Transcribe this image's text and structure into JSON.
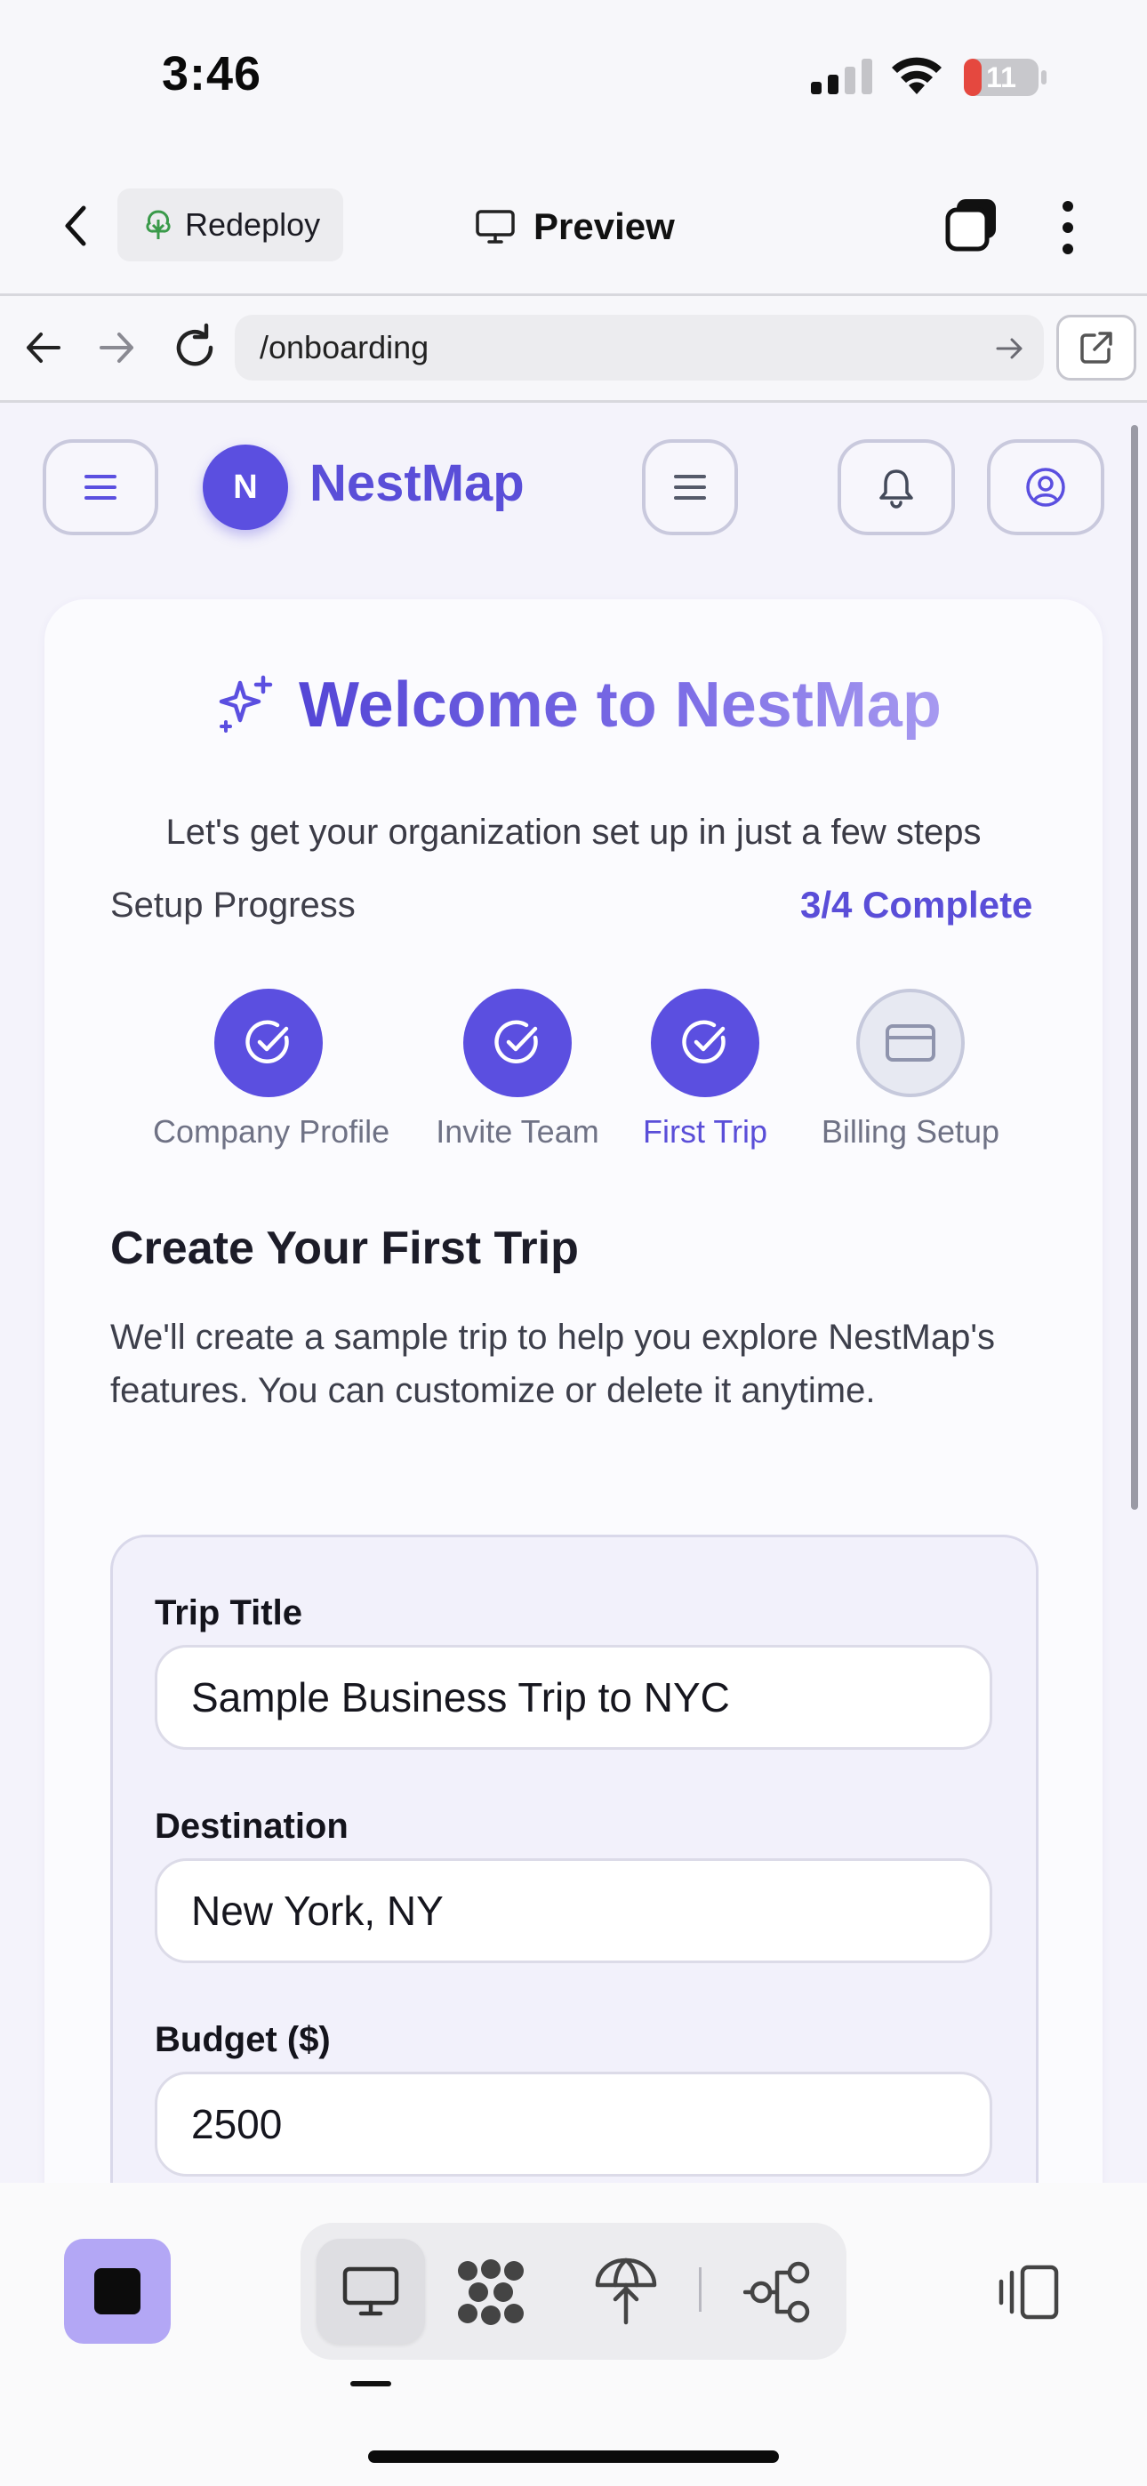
{
  "status_bar": {
    "time": "3:46",
    "battery_level": "11"
  },
  "app_header": {
    "redeploy_label": "Redeploy",
    "preview_label": "Preview"
  },
  "browser": {
    "url": "/onboarding"
  },
  "site_nav": {
    "brand_initial": "N",
    "brand_name": "NestMap"
  },
  "onboarding": {
    "title": "Welcome to NestMap",
    "subtitle": "Let's get your organization set up in just a few steps",
    "progress_label": "Setup Progress",
    "progress_value": "3/4 Complete",
    "progress_fraction": 0.75,
    "steps": [
      {
        "label": "Company Profile",
        "status": "complete",
        "icon": "check-circle-icon"
      },
      {
        "label": "Invite Team",
        "status": "complete",
        "icon": "check-circle-icon"
      },
      {
        "label": "First Trip",
        "status": "current",
        "icon": "check-circle-icon"
      },
      {
        "label": "Billing Setup",
        "status": "pending",
        "icon": "credit-card-icon"
      }
    ],
    "section_title": "Create Your First Trip",
    "section_description": "We'll create a sample trip to help you explore NestMap's features. You can customize or delete it anytime.",
    "form": {
      "trip_title_label": "Trip Title",
      "trip_title_value": "Sample Business Trip to NYC",
      "destination_label": "Destination",
      "destination_value": "New York, NY",
      "budget_label": "Budget ($)",
      "budget_value": "2500"
    }
  },
  "colors": {
    "accent": "#5b4fe0",
    "accent_light": "#b3a7f5",
    "brand_text": "#5a4ed8"
  }
}
